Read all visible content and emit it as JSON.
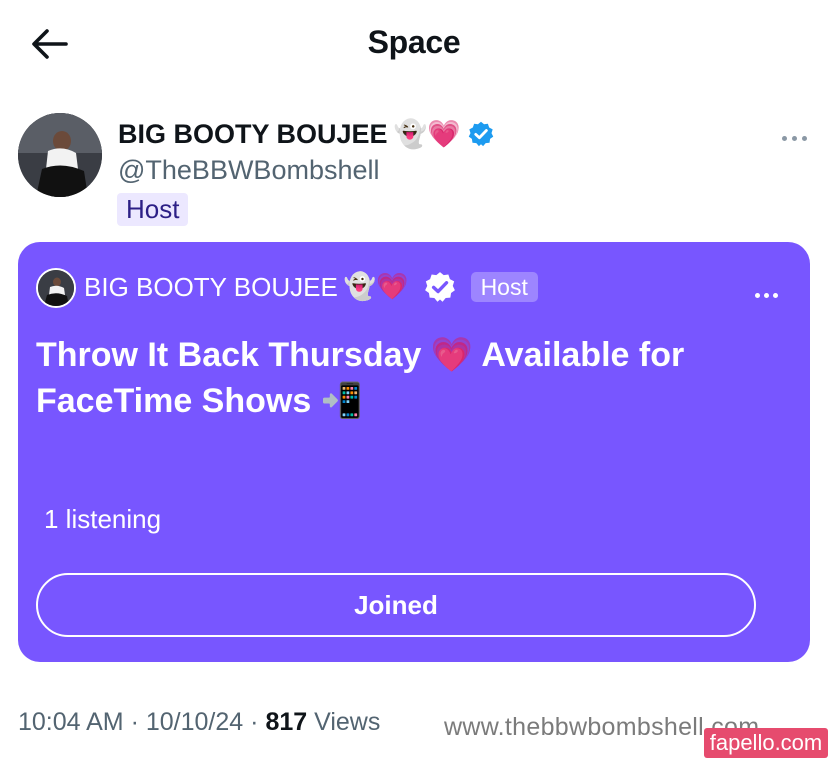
{
  "header": {
    "title": "Space",
    "back_icon": "arrow-left-icon"
  },
  "post": {
    "author_name": "BIG BOOTY BOUJEE",
    "author_emojis": "👻💗",
    "handle": "@TheBBWBombshell",
    "role_badge": "Host",
    "verified": true,
    "verified_color": "#1d9bf0"
  },
  "space_card": {
    "background_color": "#7856ff",
    "host_name": "BIG BOOTY BOUJEE",
    "host_emojis": "👻💗",
    "host_badge": "Host",
    "title_part1": "Throw It Back Thursday",
    "title_emoji1": "💗",
    "title_part2": "Available for FaceTime Shows",
    "title_emoji2": "📲",
    "listening": "1 listening",
    "joined_button": "Joined"
  },
  "meta": {
    "time": "10:04 AM",
    "separator": "·",
    "date": "10/10/24",
    "views_count": "817",
    "views_label": "Views"
  },
  "watermark": {
    "url": "www.thebbwbombshell.com",
    "badge": "fapello.com"
  }
}
